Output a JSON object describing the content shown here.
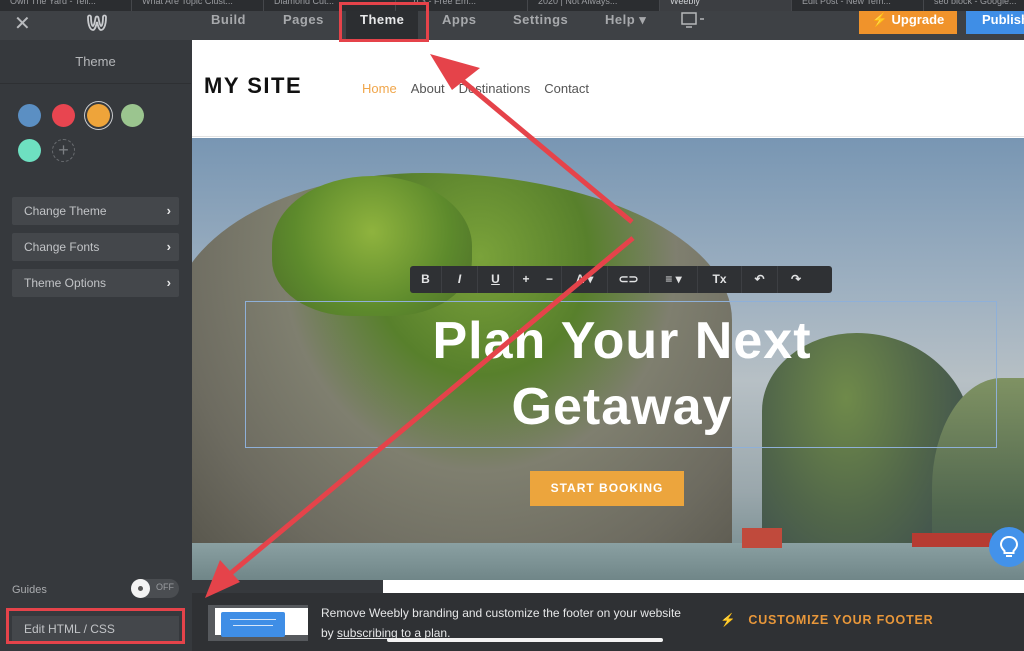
{
  "browser_tabs": [
    {
      "label": "Own The Yard - Tell...",
      "active": false
    },
    {
      "label": "What Are Topic Clust...",
      "active": false
    },
    {
      "label": "Diamond Cut...",
      "active": false
    },
    {
      "label": "...n 3 - Free Em...",
      "active": false
    },
    {
      "label": "2020 | Not Always...",
      "active": false
    },
    {
      "label": "Weebly",
      "active": true
    },
    {
      "label": "Edit Post - New Tem...",
      "active": false
    },
    {
      "label": "seo block - Google...",
      "active": false
    }
  ],
  "topbar": {
    "close_icon": "close-icon",
    "logo": "weebly-logo",
    "nav": [
      "Build",
      "Pages",
      "Theme",
      "Apps",
      "Settings",
      "Help ▾"
    ],
    "active_tab": "Theme",
    "device_icon": "desktop-icon",
    "upgrade_label": "Upgrade",
    "publish_label": "Publish"
  },
  "sidebar": {
    "title": "Theme",
    "swatches": [
      {
        "name": "blue",
        "color": "#5b8fc3",
        "selected": false
      },
      {
        "name": "red",
        "color": "#e84550",
        "selected": false
      },
      {
        "name": "orange",
        "color": "#eea43a",
        "selected": true
      },
      {
        "name": "green",
        "color": "#9bc58f",
        "selected": false
      },
      {
        "name": "teal",
        "color": "#6ee0c1",
        "selected": false
      }
    ],
    "menu": [
      "Change Theme",
      "Change Fonts",
      "Theme Options"
    ],
    "guides_label": "Guides",
    "guides_toggle": "OFF",
    "edit_html_label": "Edit HTML / CSS"
  },
  "site": {
    "title": "MY SITE",
    "nav": [
      "Home",
      "About",
      "Destinations",
      "Contact"
    ],
    "current_nav": "Home",
    "headline_line1": "Plan Your Next",
    "headline_line2": "Getaway",
    "cta_label": "START BOOKING",
    "toolbar": [
      "B",
      "I",
      "U",
      "+",
      "−",
      "A ▾",
      "⊂⊃",
      "≡ ▾",
      "Tx",
      "↶",
      "↷"
    ]
  },
  "footer_promo": {
    "text_before": "Remove Weebly branding and customize the footer on your website by ",
    "link_text": "subscribing to a plan",
    "text_after": ".",
    "cta_label": "CUSTOMIZE YOUR FOOTER"
  },
  "colors": {
    "accent_orange": "#f0932b",
    "publish_blue": "#3f8ee6",
    "annotation_red": "#e5434a",
    "link_orange": "#f0a64b"
  }
}
